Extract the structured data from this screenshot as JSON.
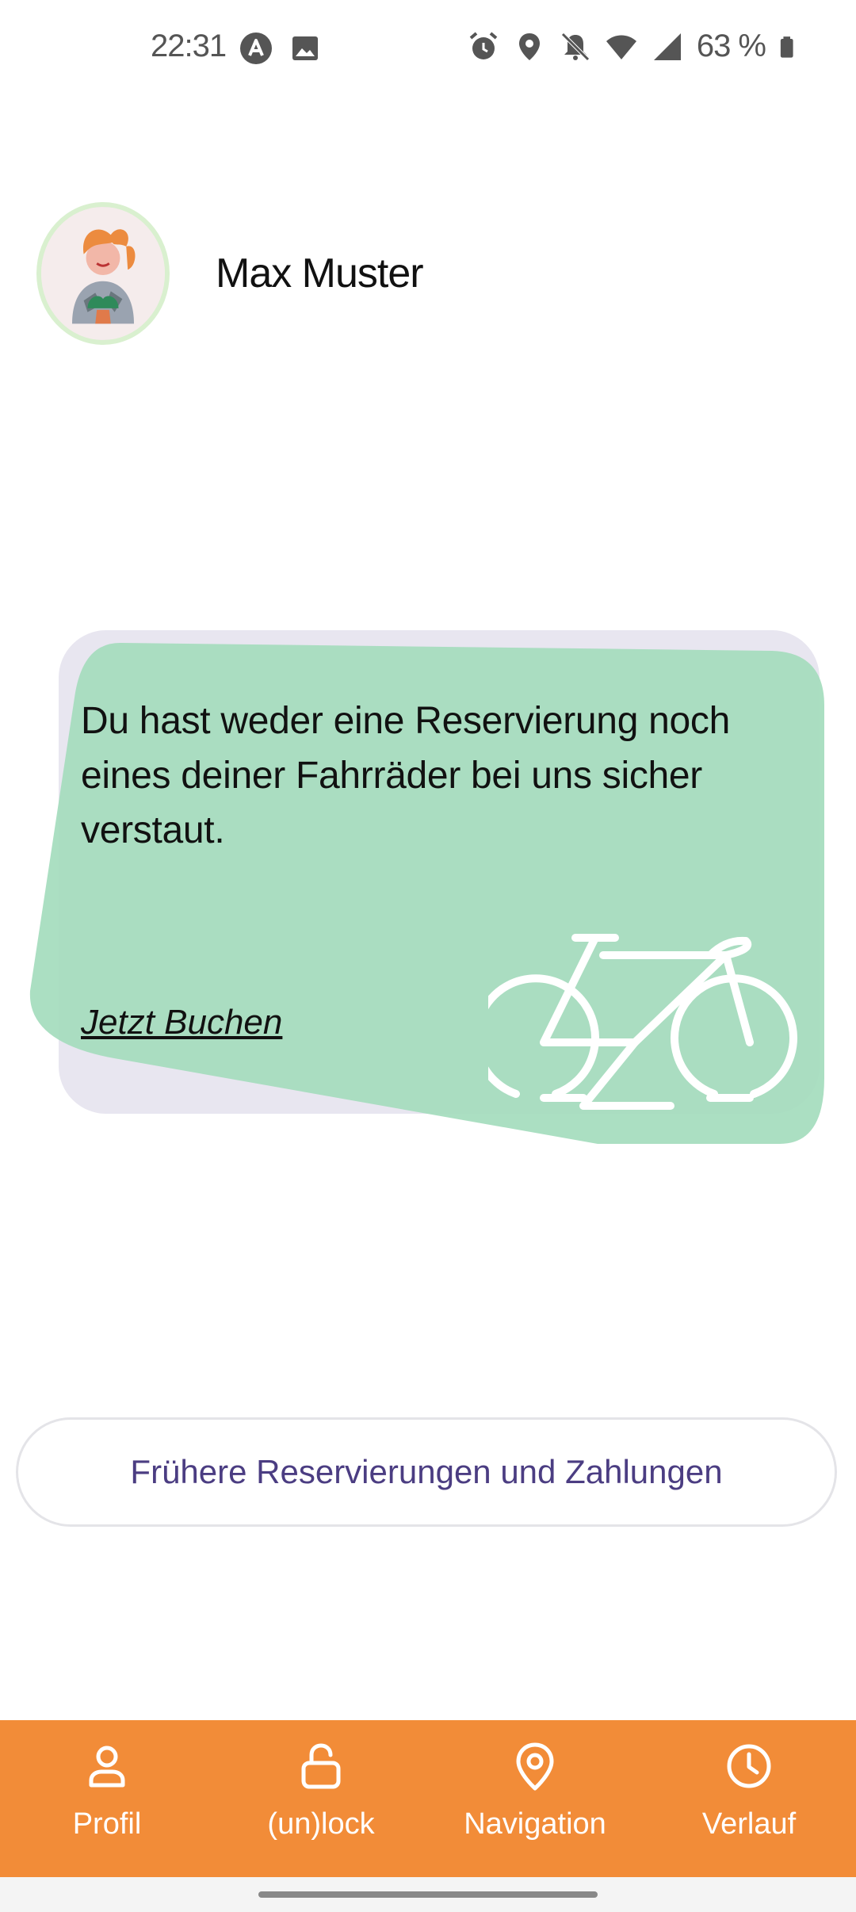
{
  "status_bar": {
    "time": "22:31",
    "battery": "63 %",
    "icons": [
      "app-icon",
      "image-icon",
      "alarm-icon",
      "location-icon",
      "mute-icon",
      "wifi-icon",
      "signal-icon",
      "battery-icon"
    ]
  },
  "profile": {
    "name": "Max Muster",
    "avatar": "avatar-illustration"
  },
  "card": {
    "message": "Du hast weder eine Reservierung noch eines deiner Fahrräder bei uns sicher verstaut.",
    "link": "Jetzt Buchen",
    "icon": "bike-icon",
    "colors": {
      "front": "#a4dcbd",
      "back": "#e8e6f0"
    }
  },
  "past_button": {
    "label": "Frühere Reservierungen und Zahlungen"
  },
  "bottom_nav": {
    "background": "#f28c38",
    "items": [
      {
        "label": "Profil",
        "icon": "person-icon"
      },
      {
        "label": "(un)lock",
        "icon": "lock-icon"
      },
      {
        "label": "Navigation",
        "icon": "location-pin-icon"
      },
      {
        "label": "Verlauf",
        "icon": "clock-icon"
      }
    ]
  }
}
